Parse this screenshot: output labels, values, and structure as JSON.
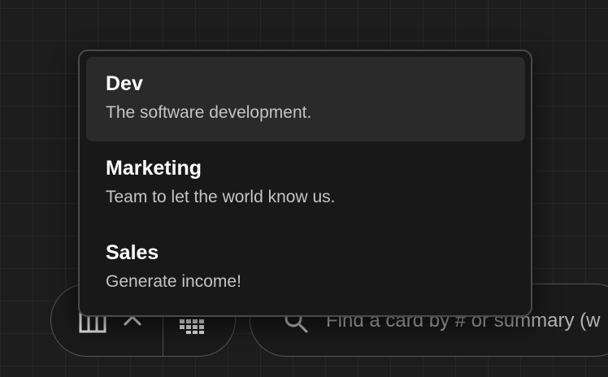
{
  "dropdown": {
    "options": [
      {
        "name": "Dev",
        "description": "The software development.",
        "active": true
      },
      {
        "name": "Marketing",
        "description": "Team to let the world know us.",
        "active": false
      },
      {
        "name": "Sales",
        "description": "Generate income!",
        "active": false
      }
    ]
  },
  "toolbar": {
    "board_icon": "board-columns-icon",
    "chevron_icon": "chevron-up-icon",
    "calendar_icon": "calendar-icon"
  },
  "search": {
    "icon": "search-icon",
    "placeholder": "Find a card by # or summary (w"
  },
  "colors": {
    "background": "#1d1d1d",
    "popover": "#181818",
    "active_item": "#2a2a2a",
    "border": "#555555",
    "text_primary": "#ffffff",
    "text_secondary": "#c4c4c4"
  }
}
